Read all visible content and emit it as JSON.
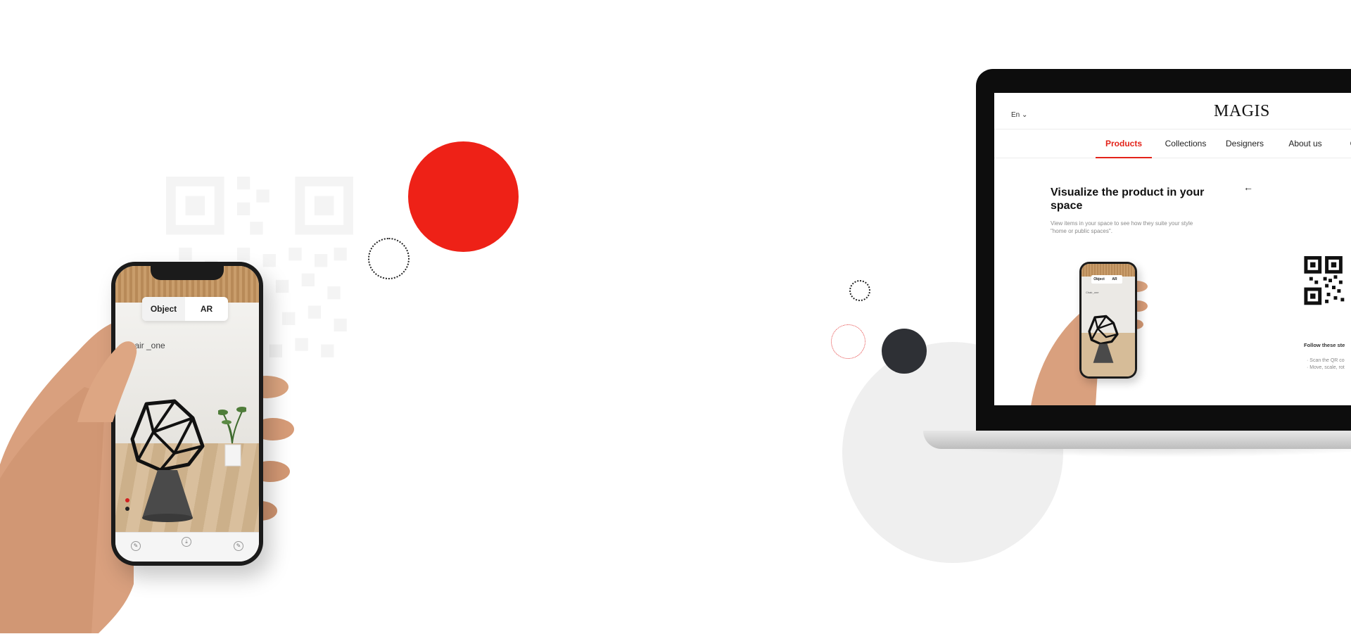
{
  "colors": {
    "accent_red": "#ee2117",
    "dark_circle": "#2e3035",
    "light_grey": "#efefef"
  },
  "phone": {
    "segmented": {
      "object_label": "Object",
      "ar_label": "AR"
    },
    "chair_name": "Chair _one",
    "swatches": [
      "#d21f1f",
      "#222222"
    ]
  },
  "website": {
    "language": "En",
    "brand": "MAGIS",
    "nav": [
      {
        "label": "Products",
        "active": true
      },
      {
        "label": "Collections",
        "active": false
      },
      {
        "label": "Designers",
        "active": false
      },
      {
        "label": "About us",
        "active": false
      }
    ],
    "title": "Visualize the product in your space",
    "description": "View items in your space to see how they suite your style \"home or public spaces\".",
    "back_icon": "arrow-left-icon",
    "mini_phone": {
      "object_label": "Object",
      "ar_label": "AR",
      "chair_name": "Chair_one"
    },
    "follow_steps_label": "Follow these ste",
    "steps": [
      "· Scan the QR co",
      "· Move, scale, rot"
    ]
  }
}
